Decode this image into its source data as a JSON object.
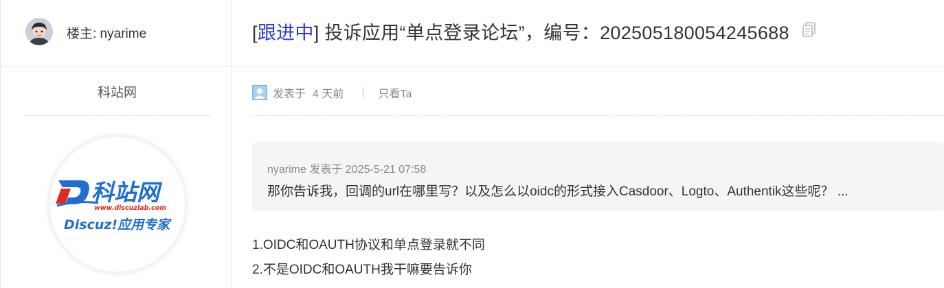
{
  "header": {
    "author_label": "楼主: nyarime",
    "status_text": "跟进中",
    "title_text": "投诉应用“单点登录论坛”，编号：202505180054245688"
  },
  "sidebar": {
    "site_name": "科站网",
    "logo": {
      "brand_text": "科站网",
      "url_text": "www.discuzlab.com",
      "slogan": "Discuz!应用专家"
    }
  },
  "post": {
    "posted_label": "发表于",
    "posted_time": "4 天前",
    "only_author": "只看Ta",
    "quote": {
      "meta": "nyarime 发表于 2025-5-21 07:58",
      "text": "那你告诉我，回调的url在哪里写？以及怎么以oidc的形式接入Casdoor、Logto、Authentik这些呢？ ..."
    },
    "lines": [
      "1.OIDC和OAUTH协议和单点登录就不同",
      "2.不是OIDC和OAUTH我干嘛要告诉你"
    ]
  },
  "colors": {
    "status_link": "#2b39d6",
    "logo_blue": "#1f6fd0",
    "logo_red": "#e0281e"
  },
  "icons": [
    "user-avatar",
    "copy-icon",
    "default-avatar-icon"
  ]
}
